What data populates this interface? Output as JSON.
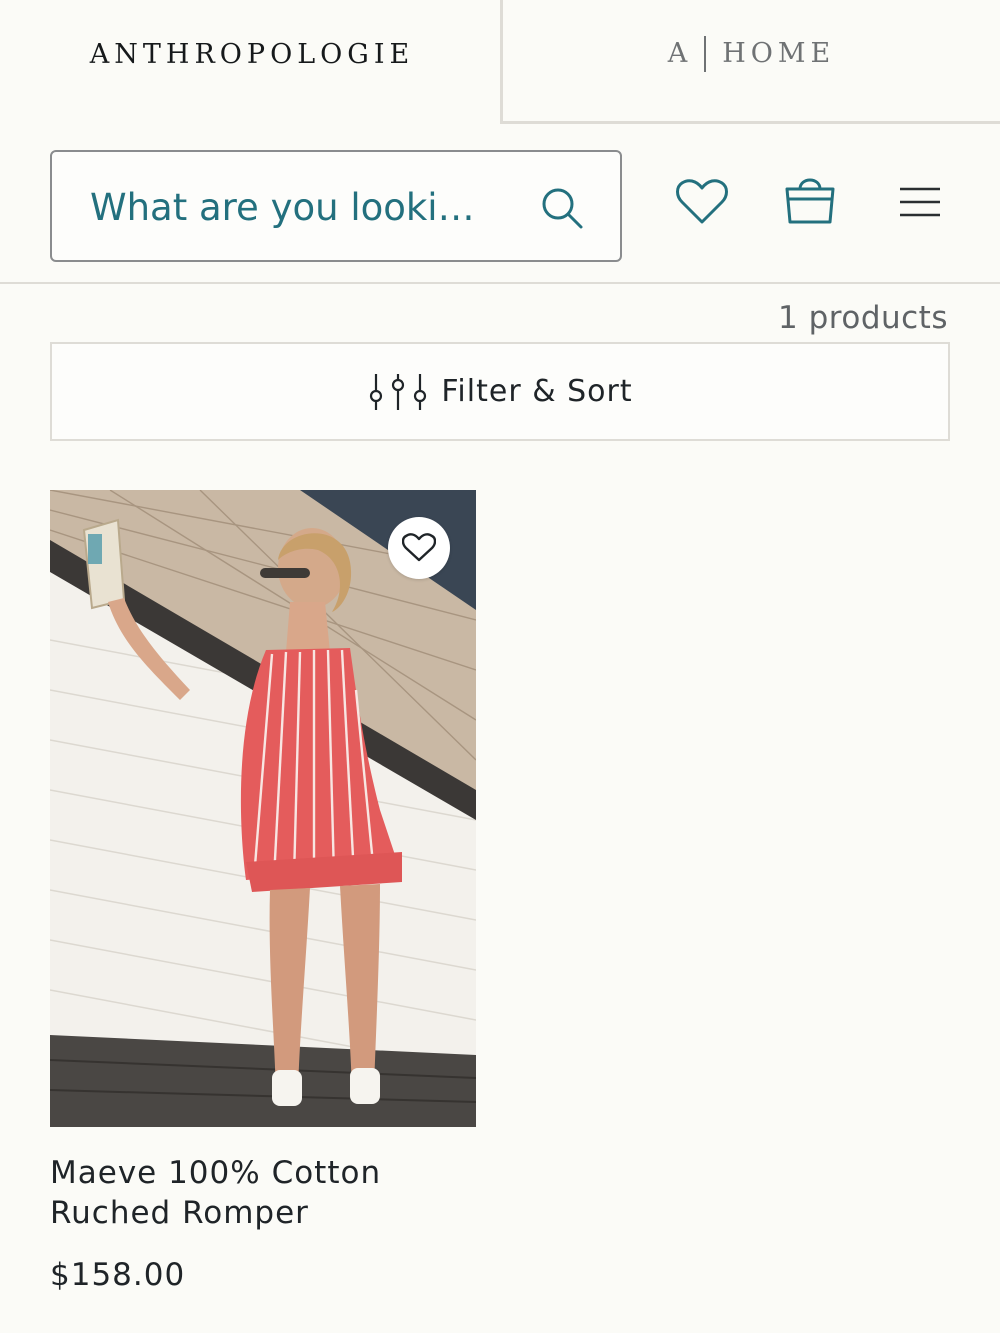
{
  "brand_tabs": {
    "primary_label": "ANTHROPOLOGIE",
    "secondary_prefix": "A",
    "secondary_label": "HOME"
  },
  "header": {
    "search_placeholder": "What are you looki…",
    "icons": [
      "search-icon",
      "heart-icon",
      "shopping-bag-icon",
      "hamburger-menu-icon"
    ]
  },
  "results": {
    "count_label": "1 products",
    "filter_label": "Filter & Sort",
    "filter_icon": "sliders-icon"
  },
  "products": [
    {
      "name": "Maeve 100% Cotton Ruched Romper",
      "price": "$158.00",
      "wishlist_icon": "heart-icon"
    }
  ],
  "colors": {
    "accent_teal": "#23707e",
    "background": "#fbfbf7",
    "border": "#dedcd6",
    "text": "#1f2428"
  }
}
